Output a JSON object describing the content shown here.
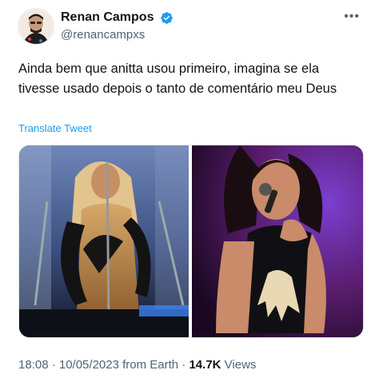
{
  "tweet": {
    "display_name": "Renan Campos",
    "handle": "@renancampxs",
    "verified": true,
    "more_icon": "more-horizontal-icon",
    "text_line1": "Ainda bem que anitta usou primeiro, imagina se ela",
    "text_line2": "tivesse usado depois o tanto de comentário meu Deus",
    "translate_label": "Translate Tweet",
    "timestamp": "18:08 · 10/05/2023 from Earth ·",
    "views_count": "14.7K",
    "views_label": "Views"
  },
  "colors": {
    "link": "#1d9bf0",
    "verified": "#1d9bf0",
    "secondary_text": "#536471"
  }
}
